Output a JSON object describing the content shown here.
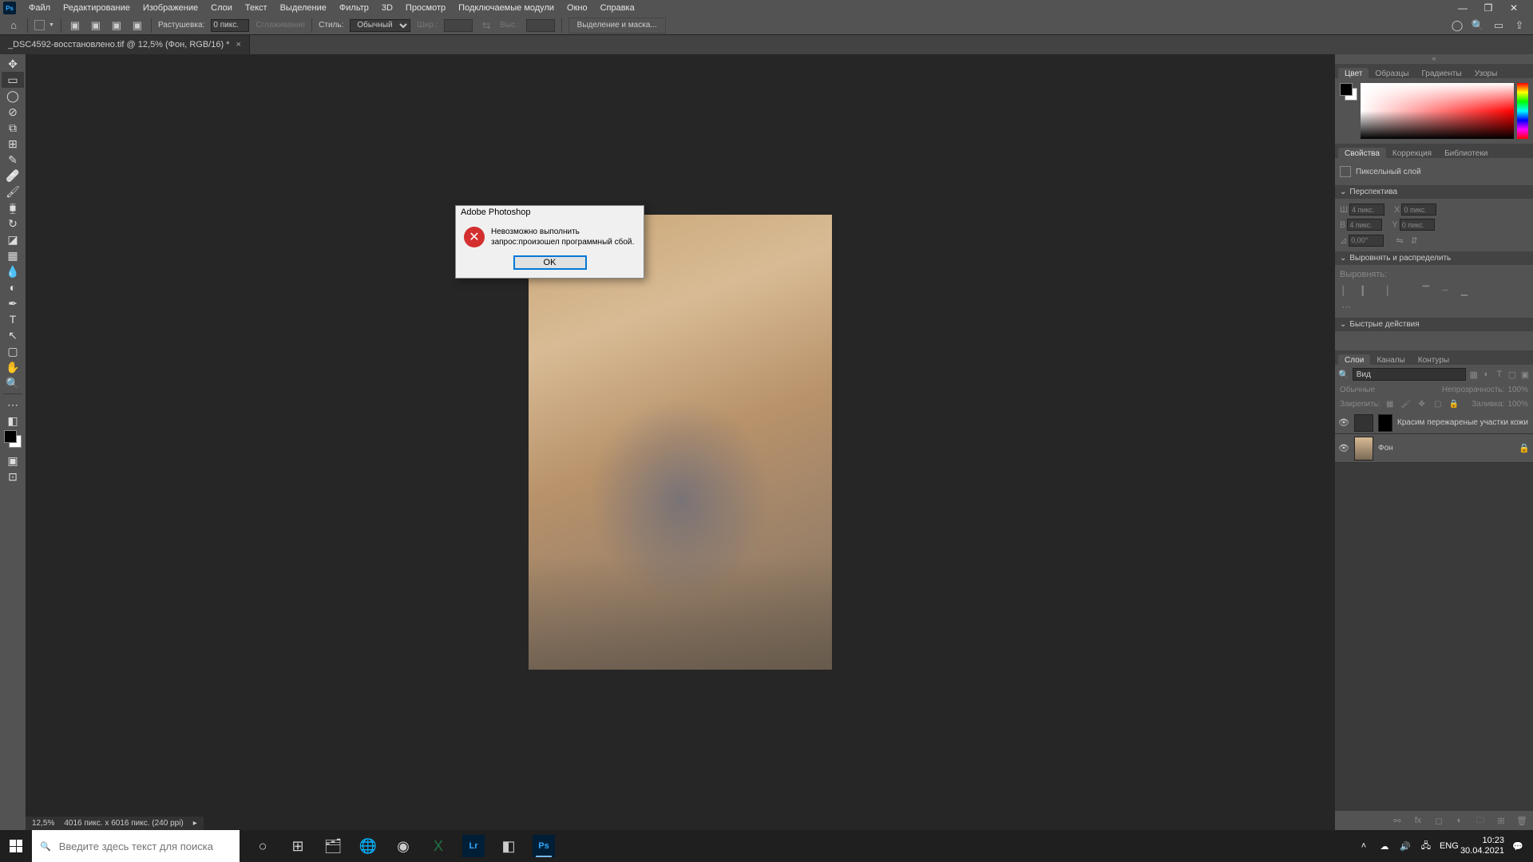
{
  "app": {
    "icon": "Ps"
  },
  "menu": [
    "Файл",
    "Редактирование",
    "Изображение",
    "Слои",
    "Текст",
    "Выделение",
    "Фильтр",
    "3D",
    "Просмотр",
    "Подключаемые модули",
    "Окно",
    "Справка"
  ],
  "options": {
    "feather_label": "Растушевка:",
    "feather_value": "0 пикс.",
    "antialias": "Сглаживание",
    "style_label": "Стиль:",
    "style_value": "Обычный",
    "width_label": "Шир.:",
    "height_label": "Выс.:",
    "select_mask": "Выделение и маска..."
  },
  "tab": {
    "title": "_DSC4592-восстановлено.tif @ 12,5% (Фон, RGB/16) *"
  },
  "status": {
    "zoom": "12,5%",
    "dims": "4016 пикс. x 6016 пикс. (240 ppi)"
  },
  "dialog": {
    "title": "Adobe Photoshop",
    "text": "Невозможно выполнить запрос:произошел программный сбой.",
    "ok": "OK"
  },
  "panels": {
    "color_tabs": [
      "Цвет",
      "Образцы",
      "Градиенты",
      "Узоры"
    ],
    "props_tabs": [
      "Свойства",
      "Коррекция",
      "Библиотеки"
    ],
    "props_header": "Пиксельный слой",
    "transform": "Перспектива",
    "align": "Выровнять и распределить",
    "align_sub": "Выровнять:",
    "quick": "Быстрые действия",
    "w": "Ш",
    "h": "В",
    "x": "X",
    "y": "Y",
    "wv": "4 пикс.",
    "hv": "4 пикс.",
    "xv": "0 пикс.",
    "yv": "0 пикс.",
    "angle": "0,00°",
    "layers_tabs": [
      "Слои",
      "Каналы",
      "Контуры"
    ],
    "search_type": "Вид",
    "blend": "Обычные",
    "opacity_label": "Непрозрачность:",
    "opacity": "100%",
    "lock": "Закрепить:",
    "fill_label": "Заливка:",
    "fill": "100%",
    "layer1": "Красим пережареные участки кожи",
    "layer_bg": "Фон"
  },
  "taskbar": {
    "search_placeholder": "Введите здесь текст для поиска",
    "lang": "ENG",
    "time": "10:23",
    "date": "30.04.2021"
  }
}
